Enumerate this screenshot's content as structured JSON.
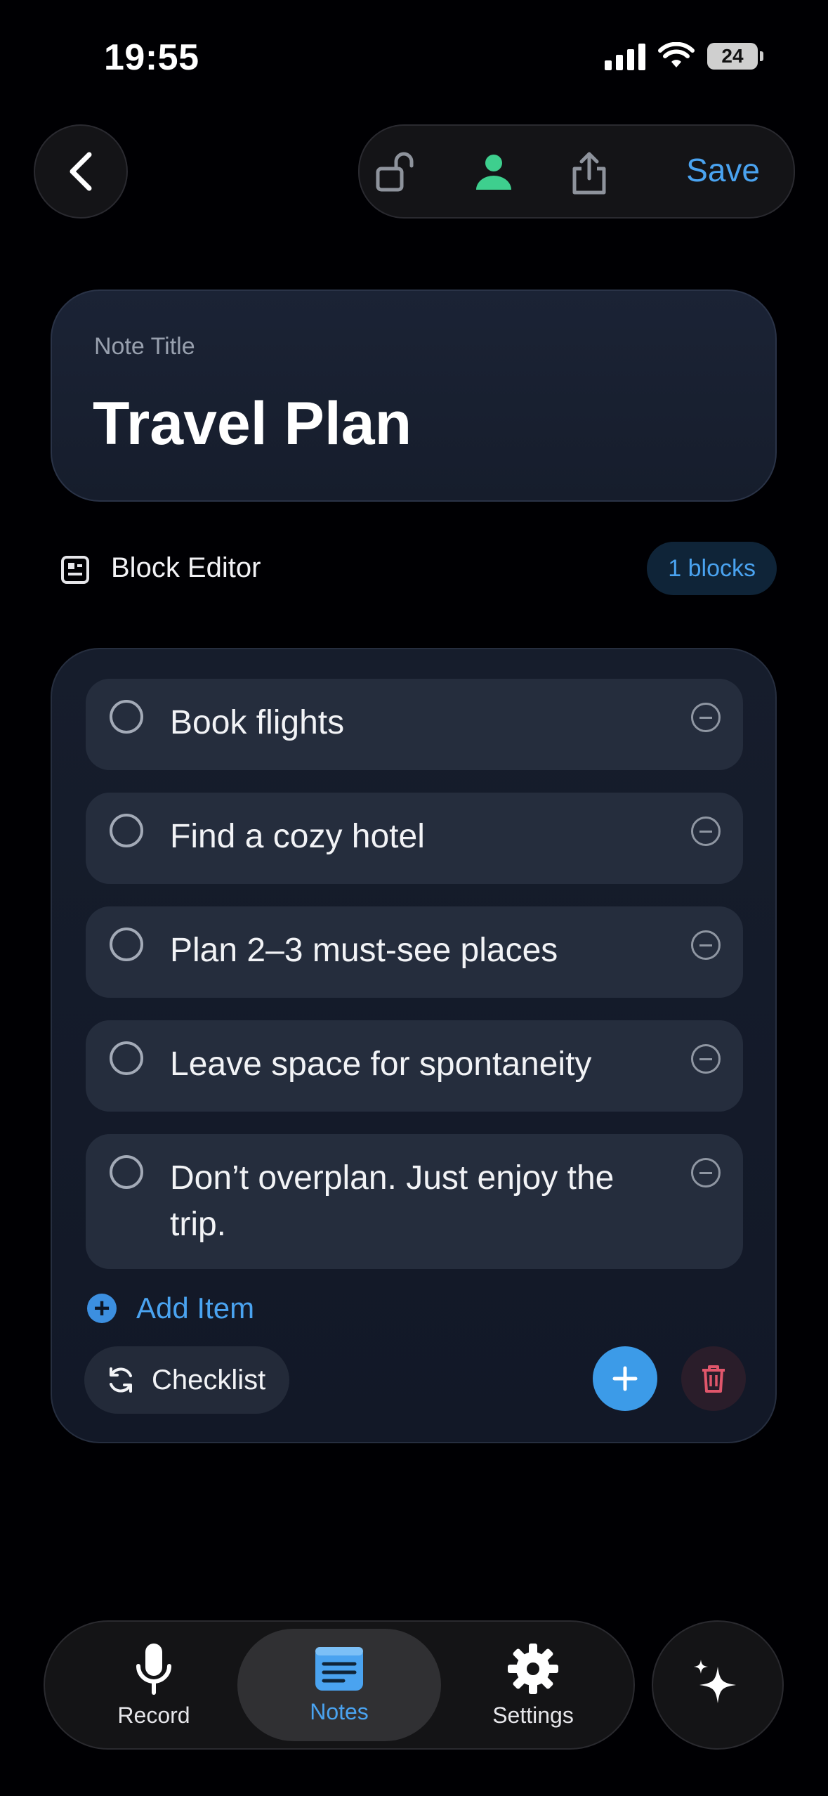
{
  "status_bar": {
    "time": "19:55",
    "battery": "24"
  },
  "toolbar": {
    "save_label": "Save",
    "icons": [
      "unlock-icon",
      "person-icon",
      "share-icon"
    ]
  },
  "note": {
    "title_label": "Note Title",
    "title_value": "Travel Plan"
  },
  "block_editor": {
    "label": "Block Editor",
    "count_badge": "1 blocks"
  },
  "checklist": {
    "items": [
      {
        "text": "Book flights",
        "checked": false
      },
      {
        "text": "Find a cozy hotel",
        "checked": false
      },
      {
        "text": "Plan 2–3 must-see places",
        "checked": false
      },
      {
        "text": "Leave space for spontaneity",
        "checked": false
      },
      {
        "text": "Don’t overplan. Just enjoy the trip.",
        "checked": false
      }
    ],
    "add_item_label": "Add Item",
    "block_type_label": "Checklist"
  },
  "tabbar": {
    "tabs": [
      {
        "label": "Record",
        "icon": "microphone-icon",
        "active": false
      },
      {
        "label": "Notes",
        "icon": "notes-icon",
        "active": true
      },
      {
        "label": "Settings",
        "icon": "gear-icon",
        "active": false
      }
    ],
    "ai_icon": "sparkles-icon"
  },
  "colors": {
    "accent": "#4aa3f0",
    "success": "#3ecf8e",
    "danger": "#e0566b",
    "background": "#000003"
  }
}
